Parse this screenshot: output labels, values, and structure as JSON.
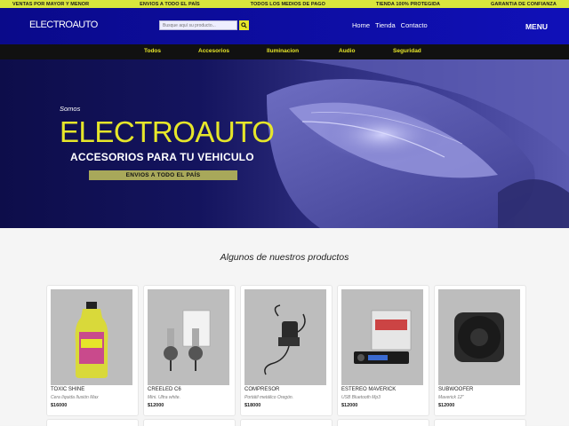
{
  "topbar": {
    "items": [
      "VENTAS POR MAYOR Y MENOR",
      "ENVIOS A TODO EL PAÍS",
      "TODOS LOS MEDIOS DE PAGO",
      "TIENDA 100% PROTEGIDA",
      "GARANTIA DE CONFIANZA"
    ]
  },
  "header": {
    "logo": "ELECTROAUTO",
    "search_placeholder": "Busque aquí su producto...",
    "nav": [
      "Home",
      "Tienda",
      "Contacto"
    ],
    "menu_label": "MENU"
  },
  "categories": [
    "Todos",
    "Accesorios",
    "Iluminacion",
    "Audio",
    "Seguridad"
  ],
  "hero": {
    "small_text": "Somos",
    "title": "ELECTROAUTO",
    "tagline": "ACCESORIOS PARA TU VEHICULO",
    "button_label": "ENVIOS A TODO EL PAÍS"
  },
  "products": {
    "section_title": "Algunos de nuestros productos",
    "items": [
      {
        "name": "TOXIC SHINE",
        "desc": "Cera líquida Ilusión Max",
        "price": "$16000",
        "icon": "bottle-icon"
      },
      {
        "name": "CREELED C6",
        "desc": "Mini. Ultra white.",
        "price": "$12000",
        "icon": "led-bulb-icon"
      },
      {
        "name": "COMPRESOR",
        "desc": "Portátil metálico Oregón.",
        "price": "$18000",
        "icon": "compressor-icon"
      },
      {
        "name": "ESTEREO MAVERICK",
        "desc": "USB Bluetooth Mp3",
        "price": "$12000",
        "icon": "car-stereo-icon"
      },
      {
        "name": "SUBWOOFER",
        "desc": "Maverick 12\"",
        "price": "$12000",
        "icon": "subwoofer-icon"
      }
    ]
  },
  "colors": {
    "topbar": "#d9e63c",
    "header": "#0a0a8a",
    "accent": "#e6e62a",
    "catbar": "#111111"
  }
}
